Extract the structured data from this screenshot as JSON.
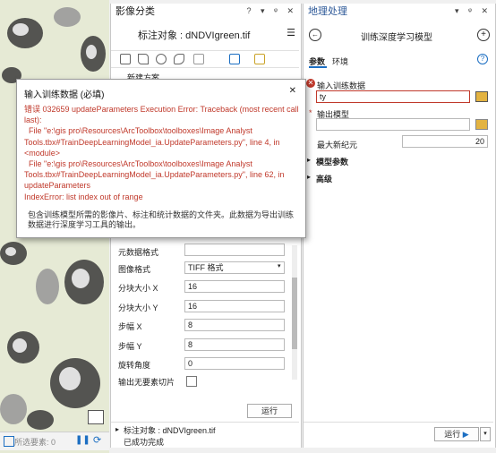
{
  "map": {
    "status_text": "所选要素: 0"
  },
  "left_panel": {
    "title": "影像分类",
    "target_heading": "标注对象 : dNDVIgreen.tif",
    "new_scheme_label": "新建方案",
    "form_rows": [
      {
        "label": "元数据格式",
        "value": ""
      },
      {
        "label": "图像格式",
        "value": "TIFF 格式"
      },
      {
        "label": "分块大小 X",
        "value": "16"
      },
      {
        "label": "分块大小 Y",
        "value": "16"
      },
      {
        "label": "步幅 X",
        "value": "8"
      },
      {
        "label": "步幅 Y",
        "value": "8"
      },
      {
        "label": "旋转角度",
        "value": "0"
      },
      {
        "label": "输出无要素切片",
        "value": ""
      }
    ],
    "run_label": "运行",
    "footer_target": "标注对象 : dNDVIgreen.tif",
    "footer_status": "已成功完成"
  },
  "right_panel": {
    "title": "地理处理",
    "tool_title": "训练深度学习模型",
    "tabs": [
      "参数",
      "环境"
    ],
    "help_icon": "?",
    "input_label": "输入训练数据",
    "input_value": "ty",
    "output_label": "输出模型",
    "output_value": "",
    "epochs_label": "最大新纪元",
    "epochs_value": "20",
    "sections": [
      "模型参数",
      "高级"
    ],
    "run_label": "运行"
  },
  "popup": {
    "title": "输入训练数据 (必填)",
    "error_text": "错误 032659 updateParameters Execution Error: Traceback (most recent call last):\n  File \"e:\\gis pro\\Resources\\ArcToolbox\\toolboxes\\Image Analyst Tools.tbx#TrainDeepLearningModel_ia.UpdateParameters.py\", line 4, in <module>\n  File \"e:\\gis pro\\Resources\\ArcToolbox\\toolboxes\\Image Analyst Tools.tbx#TrainDeepLearningModel_ia.UpdateParameters.py\", line 62, in updateParameters\nIndexError: list index out of range",
    "description": "包含训练模型所需的影像片、标注和统计数据的文件夹。此数据为导出训练数据进行深度学习工具的输出。"
  },
  "colors": {
    "accent": "#1b6ec2",
    "error": "#c0392b",
    "title_blue": "#2b5797"
  }
}
